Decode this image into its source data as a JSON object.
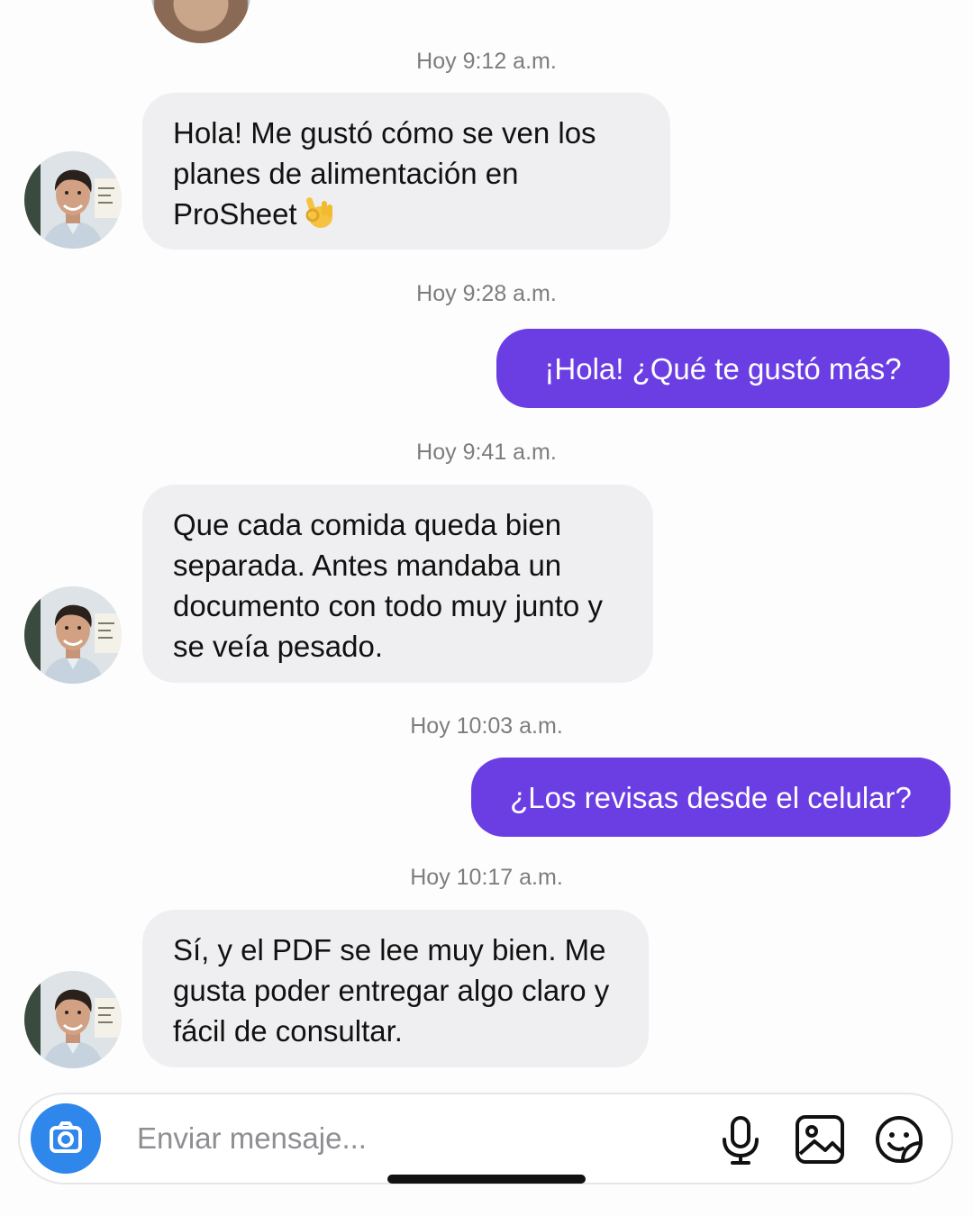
{
  "messages": [
    {
      "time": "Hoy 9:12 a.m.",
      "direction": "incoming",
      "text": "Hola! Me gustó cómo se ven los planes de alimentación en ProSheet",
      "emoji": "ok-hand-icon"
    },
    {
      "time": "Hoy 9:28 a.m.",
      "direction": "outgoing",
      "text": "¡Hola! ¿Qué te gustó más?"
    },
    {
      "time": "Hoy 9:41 a.m.",
      "direction": "incoming",
      "text": "Que cada comida queda bien separada. Antes mandaba un documento con todo muy junto y se veía pesado."
    },
    {
      "time": "Hoy 10:03 a.m.",
      "direction": "outgoing",
      "text": "¿Los revisas desde el celular?"
    },
    {
      "time": "Hoy 10:17 a.m.",
      "direction": "incoming",
      "text": "Sí, y el PDF se lee muy bien. Me gusta poder entregar algo claro y fácil de consultar."
    }
  ],
  "composer": {
    "placeholder": "Enviar mensaje...",
    "value": "",
    "camera_icon": "camera-icon",
    "tools": [
      "microphone-icon",
      "image-icon",
      "sticker-icon"
    ]
  },
  "colors": {
    "incoming_bubble": "#efeff1",
    "outgoing_bubble": "#6b3ee3",
    "camera_button": "#2f86eb",
    "timestamp": "#7d7d7d"
  }
}
